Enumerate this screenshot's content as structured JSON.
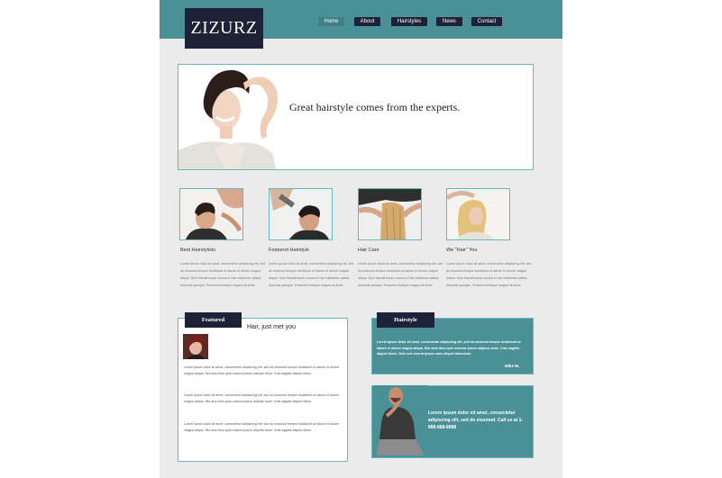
{
  "header": {
    "logo": "ZIZURZ",
    "nav": [
      {
        "label": "Home",
        "active": true
      },
      {
        "label": "About",
        "active": false
      },
      {
        "label": "Hairstyles",
        "active": false
      },
      {
        "label": "News",
        "active": false
      },
      {
        "label": "Contact",
        "active": false
      }
    ]
  },
  "hero": {
    "tagline": "Great hairstyle comes from the experts."
  },
  "columns": [
    {
      "title": "Best Hairstylists",
      "text": "Lorem ipsum dolor sit amet, consectetur adipiscing elit, sed do eiusmod tempor incididunt ut labore et dolore magna aliqua. Duis blandit turpis cursus in hac habitasse platea dictumst quisque. Praesent tristique magna sit amet."
    },
    {
      "title": "Featured Hairstyle",
      "text": "Lorem ipsum dolor sit amet, consectetur adipiscing elit, sed do eiusmod tempor incididunt ut labore et dolore magna aliqua. Duis blandit turpis cursus in hac habitasse platea dictumst quisque. Praesent tristique magna sit amet."
    },
    {
      "title": "Hair Care",
      "text": "Lorem ipsum dolor sit amet, consectetur adipiscing elit, sed do eiusmod tempor incididunt ut labore et dolore magna aliqua. Duis blandit turpis cursus in hac habitasse platea dictumst quisque. Praesent tristique magna sit amet."
    },
    {
      "title": "We \"Hair\" You",
      "text": "Lorem ipsum dolor sit amet, consectetur adipiscing elit, sed do eiusmod tempor incididunt ut labore et dolore magna aliqua. Duis blandit turpis cursus in hac habitasse platea dictumst quisque. Praesent tristique magna sit amet."
    }
  ],
  "featured": {
    "tag": "Featured",
    "title": "Hair, just met you",
    "paragraphs": [
      "Lorem ipsum dolor sit amet, consectetur adipiscing elit, sed do eiusmod tempor incididunt ut labore et dolore magna aliqua. Nisi arcu litus quis nostrud ipsum adipisci dolor. Cras sagittis aliquet libero.",
      "Lorem ipsum dolor sit amet, consectetur adipiscing elit, sed do eiusmod tempor incididunt ut labore et dolore magna aliqua. Nisi arcu litus quis nostrud ipsum adipisci dolor. Cras sagittis aliquet libero.",
      "Lorem ipsum dolor sit amet, consectetur adipiscing elit, sed do eiusmod tempor incididunt ut labore et dolore magna aliqua. Nisi arcu litus quis nostrud ipsum adipisci dolor. Cras sagittis aliquet libero."
    ]
  },
  "testimonial": {
    "tag": "Hairstyle",
    "quote": "Lorem ipsum dolor sit amet, consectetur adipiscing elit, sed do eiusmod tempor incididunt ut labore et dolore magna aliqua. Nisi arcu litus quis nostrud ipsum adipisci dolor. Cras sagittis aliquet libero. Duis sed viverra ipsum nunc aliquet bibendum.",
    "author": "Mike M."
  },
  "contact": {
    "text": "Lorem ipsum dolor sit amet, consectetur adipiscing elit, sed do eiusmod. Call us at 1-888-888-8888"
  },
  "colors": {
    "teal": "#4a9096",
    "navy": "#1e2238",
    "border": "#66b7bd",
    "background": "#ebebeb"
  }
}
